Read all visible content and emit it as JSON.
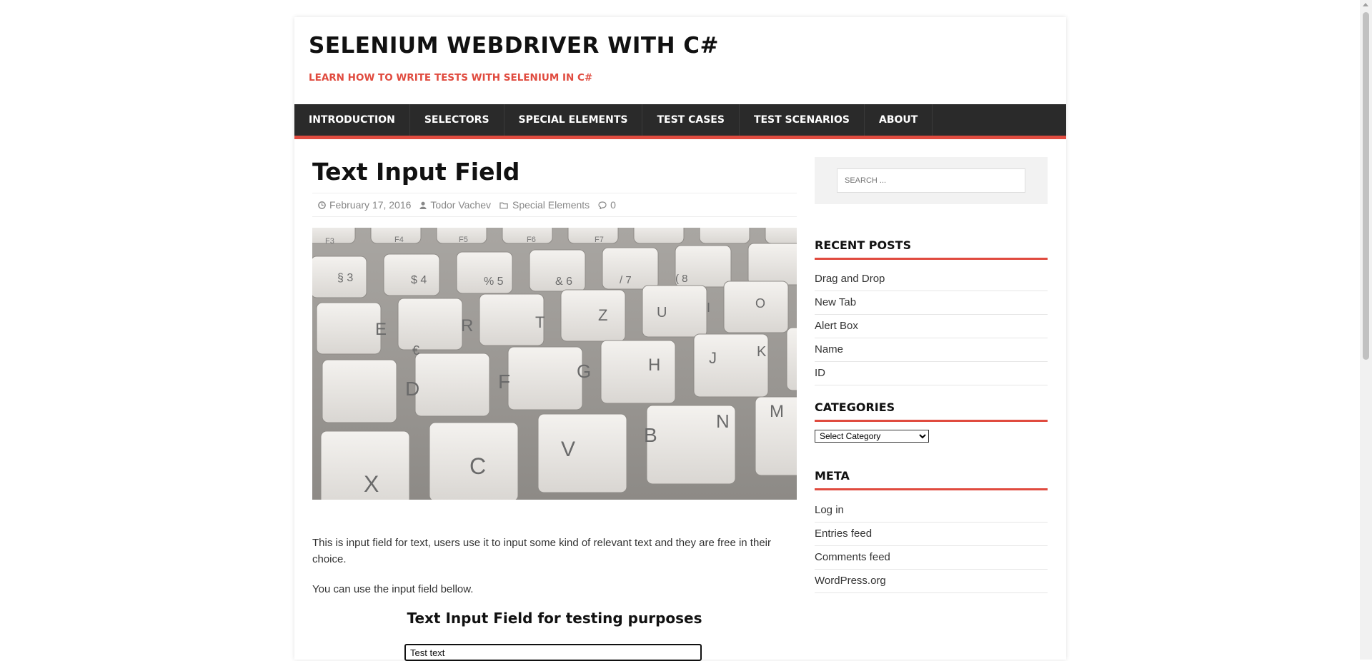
{
  "header": {
    "site_title": "SELENIUM WEBDRIVER WITH C#",
    "site_description": "LEARN HOW TO WRITE TESTS WITH SELENIUM IN C#"
  },
  "nav": {
    "items": [
      "INTRODUCTION",
      "SELECTORS",
      "SPECIAL ELEMENTS",
      "TEST CASES",
      "TEST SCENARIOS",
      "ABOUT"
    ]
  },
  "post": {
    "title": "Text Input Field",
    "date": "February 17, 2016",
    "author": "Todor Vachev",
    "category": "Special Elements",
    "comments": "0",
    "paragraph1": "This is input field for text, users use it to input some kind of relevant text and they are free in their choice.",
    "paragraph2": "You can use the input field bellow.",
    "demo_title": "Text Input Field for testing purposes",
    "demo_input_value": "Test text",
    "image_keys": {
      "row1": [
        "F3",
        "F4",
        "F5",
        "F6",
        "F7"
      ],
      "row2": [
        "§ 3",
        "$ 4",
        "% 5",
        "& 6",
        "/ 7",
        "( 8"
      ],
      "row3": [
        "E",
        "R",
        "T",
        "Z",
        "U",
        "I",
        "O"
      ],
      "row4": [
        "D",
        "F",
        "G",
        "H",
        "J",
        "K"
      ],
      "row5": [
        "X",
        "C",
        "V",
        "B",
        "N",
        "M"
      ],
      "euro": "€"
    }
  },
  "sidebar": {
    "search_placeholder": "SEARCH ...",
    "recent_title": "RECENT POSTS",
    "recent_posts": [
      "Drag and Drop",
      "New Tab",
      "Alert Box",
      "Name",
      "ID"
    ],
    "categories_title": "CATEGORIES",
    "categories_select": "Select Category",
    "meta_title": "META",
    "meta_links": [
      "Log in",
      "Entries feed",
      "Comments feed",
      "WordPress.org"
    ]
  },
  "colors": {
    "accent": "#e04b3f",
    "nav_bg": "#2a2a2a"
  },
  "icons": {
    "date": "clock-icon",
    "author": "user-icon",
    "category": "folder-icon",
    "comments": "comment-icon"
  }
}
